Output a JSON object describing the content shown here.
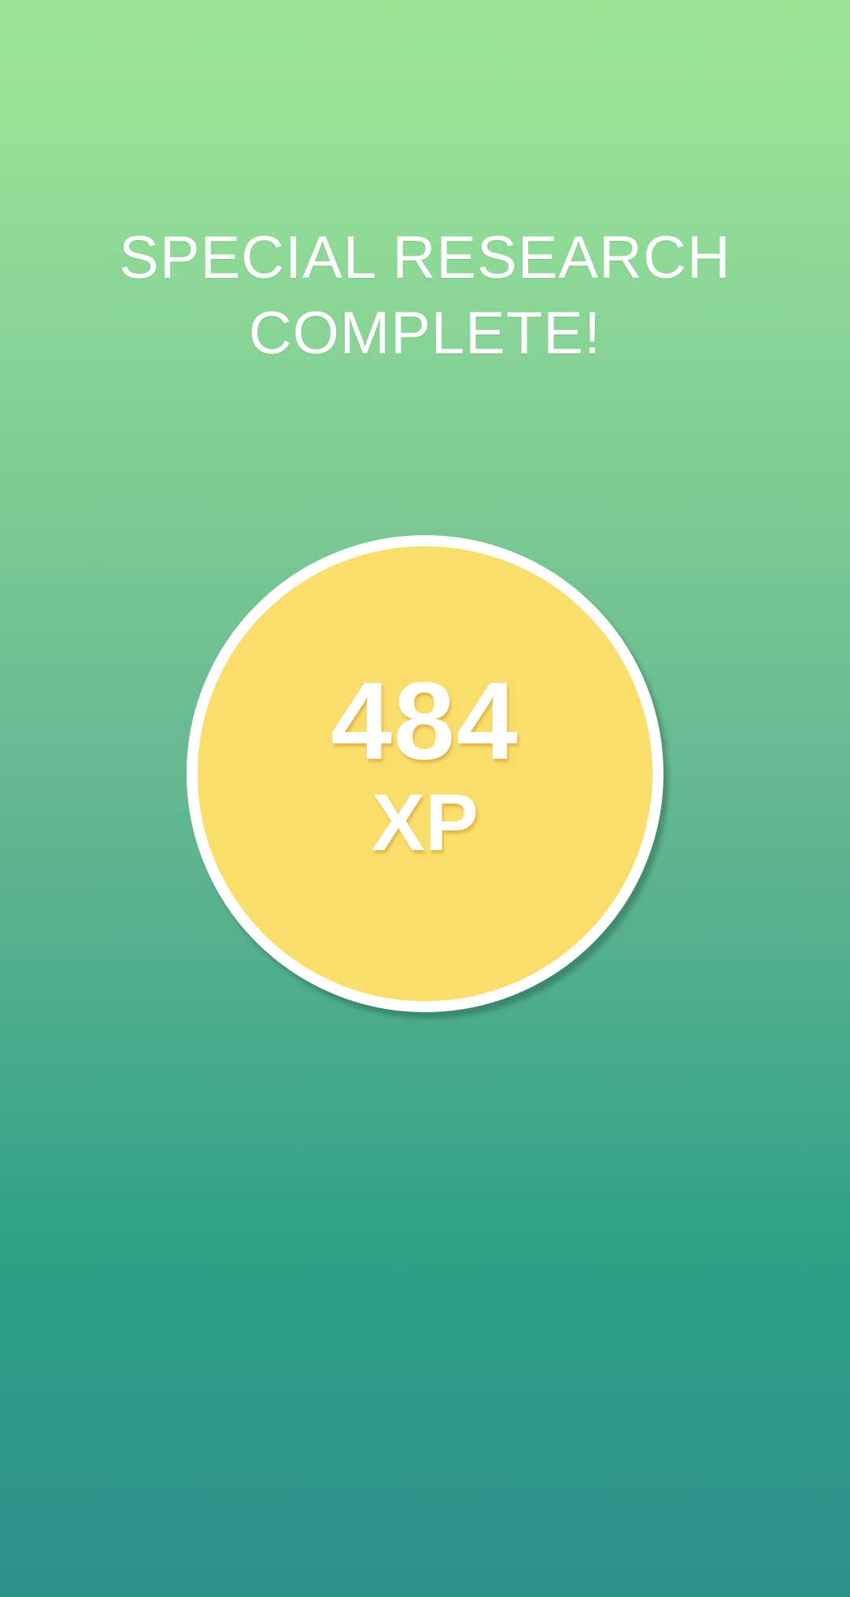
{
  "screen": {
    "title_line1": "SPECIAL RESEARCH",
    "title_line2": "COMPLETE!"
  },
  "reward": {
    "amount": "484",
    "unit": "XP"
  },
  "colors": {
    "background_top": "#9ae395",
    "background_bottom": "#2c928a",
    "circle_fill": "#fbdd6b",
    "circle_border": "#ffffff",
    "text": "#ffffff"
  }
}
